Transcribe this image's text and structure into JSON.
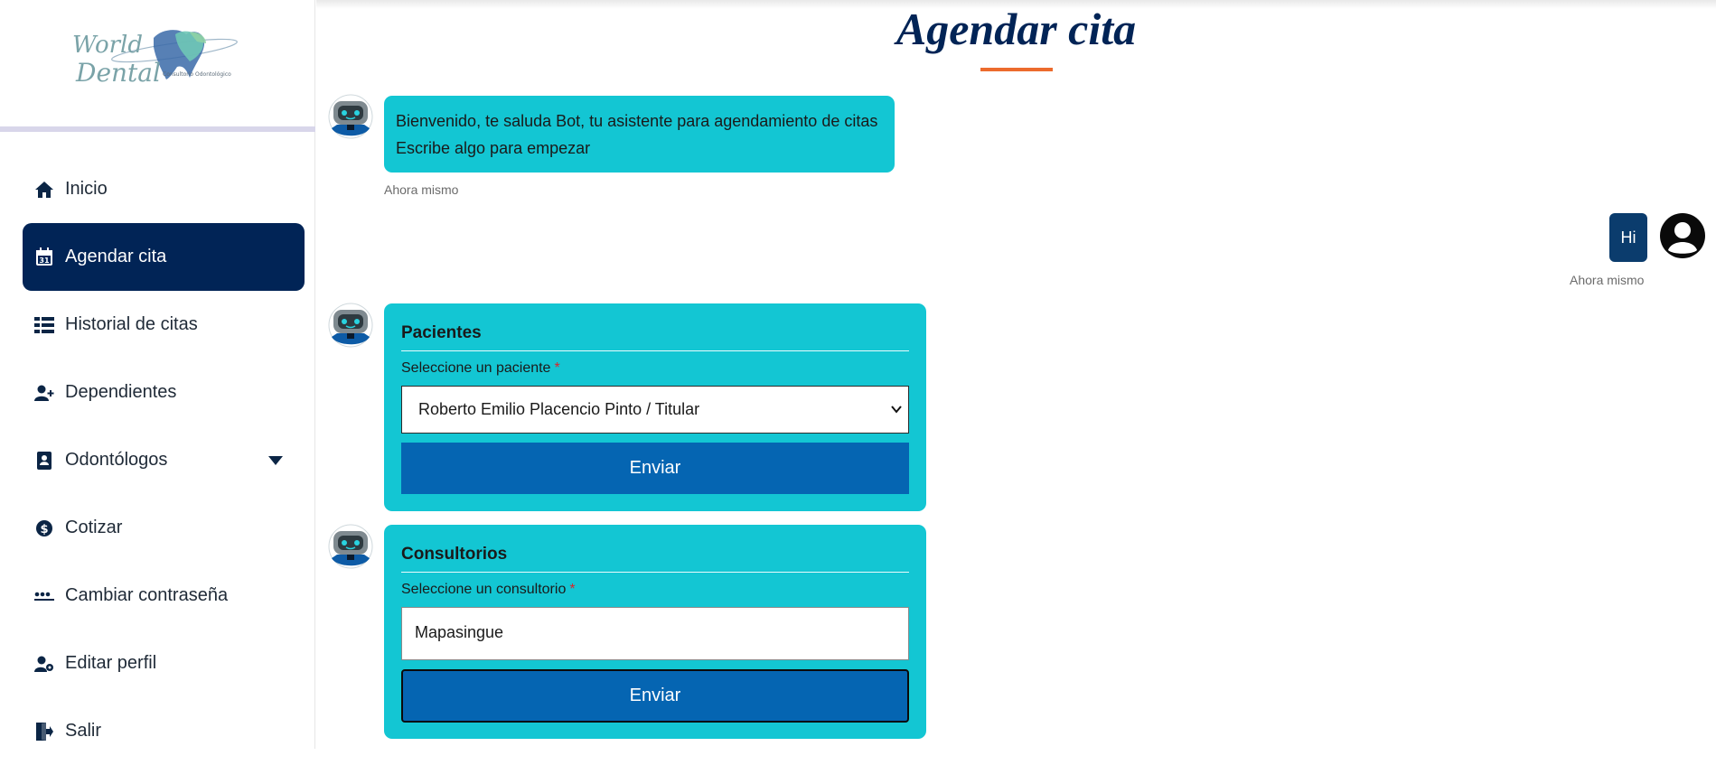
{
  "brand": {
    "logo_line1": "World",
    "logo_line2": "Dental",
    "logo_subtitle": "Consultorio Odontológico"
  },
  "sidebar": {
    "items": [
      {
        "label": "Inicio",
        "icon": "home-icon",
        "active": false
      },
      {
        "label": "Agendar cita",
        "icon": "calendar-31-icon",
        "active": true
      },
      {
        "label": "Historial de citas",
        "icon": "list-table-icon",
        "active": false
      },
      {
        "label": "Dependientes",
        "icon": "user-plus-icon",
        "active": false
      },
      {
        "label": "Odontólogos",
        "icon": "id-badge-icon",
        "active": false,
        "has_dropdown": true
      },
      {
        "label": "Cotizar",
        "icon": "dollar-circle-icon",
        "active": false
      },
      {
        "label": "Cambiar contraseña",
        "icon": "password-dots-icon",
        "active": false
      },
      {
        "label": "Editar perfil",
        "icon": "user-gear-icon",
        "active": false
      },
      {
        "label": "Salir",
        "icon": "sign-out-icon",
        "active": false
      }
    ]
  },
  "page": {
    "title": "Agendar cita"
  },
  "chat": {
    "welcome": {
      "line1": "Bienvenido, te saluda Bot, tu asistente para agendamiento de citas",
      "line2": "Escribe algo para empezar",
      "time": "Ahora mismo"
    },
    "user_message": {
      "text": "Hi",
      "time": "Ahora mismo"
    },
    "patients_card": {
      "title": "Pacientes",
      "label": "Seleccione un paciente",
      "required_mark": "*",
      "selected": "Roberto Emilio Placencio Pinto / Titular",
      "button": "Enviar"
    },
    "offices_card": {
      "title": "Consultorios",
      "label": "Seleccione un consultorio",
      "required_mark": "*",
      "value": "Mapasingue",
      "button": "Enviar"
    }
  },
  "colors": {
    "navy": "#012456",
    "bubble": "#13c6d3",
    "button": "#0565b2",
    "accent": "#ec6b2d",
    "user_bubble": "#0b3c6d"
  }
}
